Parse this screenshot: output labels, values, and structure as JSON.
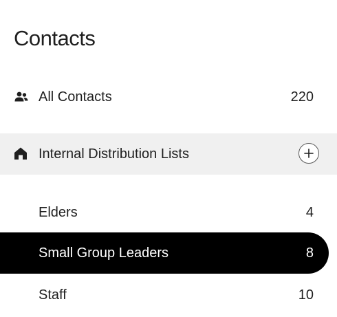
{
  "header": {
    "title": "Contacts"
  },
  "all_contacts": {
    "label": "All Contacts",
    "count": "220",
    "icon": "people-icon"
  },
  "section": {
    "label": "Internal Distribution Lists",
    "icon": "home-icon",
    "add_icon": "plus-icon"
  },
  "lists": [
    {
      "label": "Elders",
      "count": "4",
      "selected": false
    },
    {
      "label": "Small Group Leaders",
      "count": "8",
      "selected": true
    },
    {
      "label": "Staff",
      "count": "10",
      "selected": false
    }
  ],
  "colors": {
    "selected_bg": "#000000",
    "selected_text": "#ffffff",
    "section_bg": "#f0f0f0",
    "text": "#1f1f1f"
  }
}
